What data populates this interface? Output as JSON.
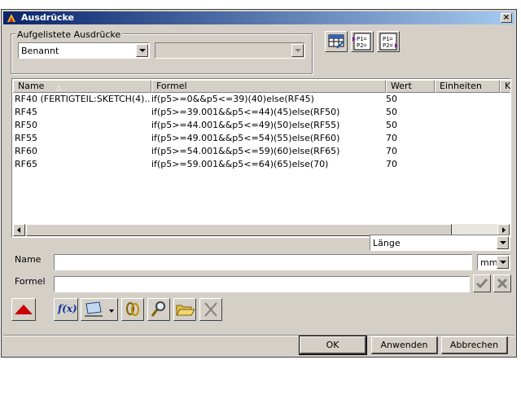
{
  "window": {
    "title": "Ausdrücke",
    "close_label": "×"
  },
  "filter": {
    "group_label": "Aufgelistete Ausdrücke",
    "selected": "Benannt",
    "secondary_selected": ""
  },
  "toolbar_icons": [
    "spreadsheet-icon",
    "p1-p2-import-icon",
    "p1-p2-export-icon"
  ],
  "icon_text": {
    "p1": "P1=",
    "p2": "P2="
  },
  "table": {
    "columns": [
      "Name",
      "Formel",
      "Wert",
      "Einheiten",
      "Ko"
    ],
    "rows": [
      {
        "name": "RF40  (FERTIGTEIL:SKETCH(4)...",
        "formula": "if(p5>=0&&p5<=39)(40)else(RF45)",
        "value": "50",
        "unit": ""
      },
      {
        "name": "RF45",
        "formula": "if(p5>=39.001&&p5<=44)(45)else(RF50)",
        "value": "50",
        "unit": ""
      },
      {
        "name": "RF50",
        "formula": "if(p5>=44.001&&p5<=49)(50)else(RF55)",
        "value": "50",
        "unit": ""
      },
      {
        "name": "RF55",
        "formula": "if(p5>=49.001&&p5<=54)(55)else(RF60)",
        "value": "70",
        "unit": ""
      },
      {
        "name": "RF60",
        "formula": "if(p5>=54.001&&p5<=59)(60)else(RF65)",
        "value": "70",
        "unit": ""
      },
      {
        "name": "RF65",
        "formula": "if(p5>=59.001&&p5<=64)(65)else(70)",
        "value": "70",
        "unit": ""
      }
    ]
  },
  "type_select": {
    "selected": "Länge"
  },
  "name_field": {
    "label": "Name",
    "value": "",
    "unit": "mm"
  },
  "formula_field": {
    "label": "Formel",
    "value": ""
  },
  "function_label": "f(x)",
  "buttons": {
    "ok": "OK",
    "apply": "Anwenden",
    "cancel": "Abbrechen"
  },
  "colors": {
    "title_start": "#0a246a",
    "title_end": "#a6caf0",
    "accent_red": "#cc0000"
  }
}
